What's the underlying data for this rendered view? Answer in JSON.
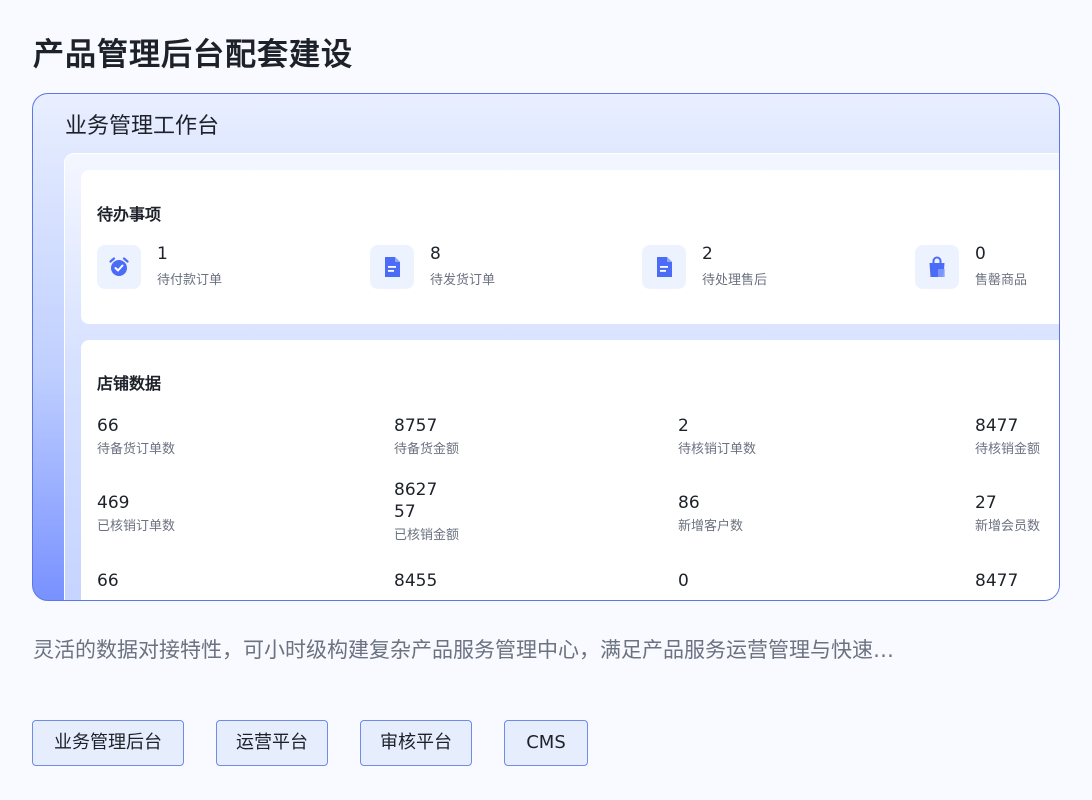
{
  "page": {
    "title": "产品管理后台配套建设",
    "description": "灵活的数据对接特性，可小时级构建复杂产品服务管理中心，满足产品服务运营管理与快速…"
  },
  "preview": {
    "title": "业务管理工作台",
    "todo": {
      "title": "待办事项",
      "items": [
        {
          "value": "1",
          "label": "待付款订单",
          "icon": "alarm-clock-icon"
        },
        {
          "value": "8",
          "label": "待发货订单",
          "icon": "document-icon"
        },
        {
          "value": "2",
          "label": "待处理售后",
          "icon": "document-icon"
        },
        {
          "value": "0",
          "label": "售罄商品",
          "icon": "shopping-bag-icon"
        }
      ]
    },
    "store": {
      "title": "店铺数据",
      "stats": [
        {
          "value": "66",
          "label": "待备货订单数"
        },
        {
          "value": "8757",
          "label": "待备货金额"
        },
        {
          "value": "2",
          "label": "待核销订单数"
        },
        {
          "value": "8477",
          "label": "待核销金额"
        },
        {
          "value": "469",
          "label": "已核销订单数"
        },
        {
          "value": "862757",
          "label": "已核销金额"
        },
        {
          "value": "86",
          "label": "新增客户数"
        },
        {
          "value": "27",
          "label": "新增会员数"
        },
        {
          "value": "66",
          "label": ""
        },
        {
          "value": "8455",
          "label": ""
        },
        {
          "value": "0",
          "label": ""
        },
        {
          "value": "8477",
          "label": ""
        }
      ]
    }
  },
  "tags": [
    "业务管理后台",
    "运营平台",
    "审核平台",
    "CMS"
  ],
  "colors": {
    "accent": "#4a6cf7",
    "tag_border": "#6f8ce8",
    "tag_background": "#e6edfd",
    "card_border": "#5b78e6"
  }
}
